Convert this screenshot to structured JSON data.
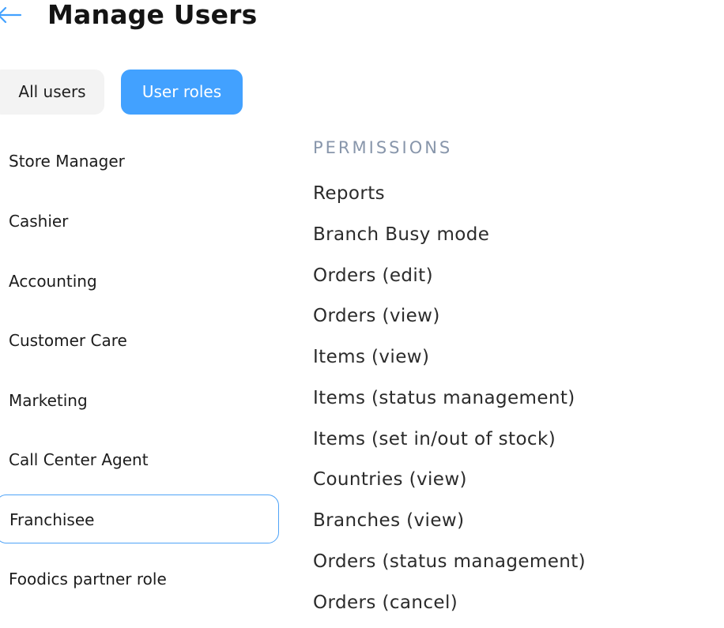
{
  "header": {
    "title": "Manage Users"
  },
  "tabs": [
    {
      "label": "All users",
      "active": false
    },
    {
      "label": "User roles",
      "active": true
    }
  ],
  "roles": [
    {
      "label": "Store Manager",
      "selected": false
    },
    {
      "label": "Cashier",
      "selected": false
    },
    {
      "label": "Accounting",
      "selected": false
    },
    {
      "label": "Customer Care",
      "selected": false
    },
    {
      "label": "Marketing",
      "selected": false
    },
    {
      "label": "Call Center Agent",
      "selected": false
    },
    {
      "label": "Franchisee",
      "selected": true
    },
    {
      "label": "Foodics partner role",
      "selected": false
    }
  ],
  "permissions": {
    "title": "PERMISSIONS",
    "items": [
      "Reports",
      "Branch Busy mode",
      "Orders (edit)",
      "Orders (view)",
      "Items (view)",
      "Items (status management)",
      "Items (set in/out of stock)",
      "Countries (view)",
      "Branches (view)",
      "Orders (status management)",
      "Orders (cancel)"
    ]
  },
  "colors": {
    "accent": "#42a1ff",
    "selected_border": "#4fa3f7",
    "tab_inactive_bg": "#f3f3f3",
    "permissions_title": "#8896ab"
  },
  "icons": {
    "back": "arrow-left-icon"
  }
}
